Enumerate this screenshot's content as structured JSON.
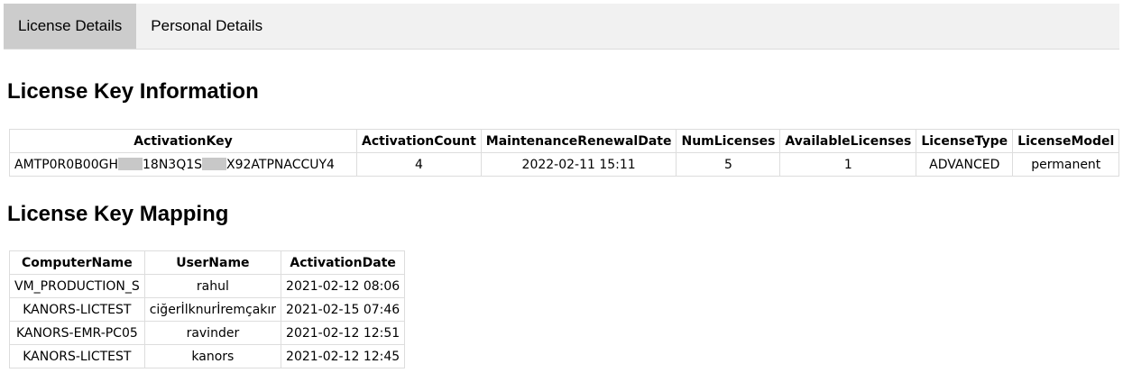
{
  "tabs": [
    {
      "label": "License Details",
      "active": true
    },
    {
      "label": "Personal Details",
      "active": false
    }
  ],
  "info": {
    "heading": "License Key Information",
    "headers": [
      "ActivationKey",
      "ActivationCount",
      "MaintenanceRenewalDate",
      "NumLicenses",
      "AvailableLicenses",
      "LicenseType",
      "LicenseModel"
    ],
    "row": {
      "key_part1": "AMTP0R0B00GH",
      "key_part2": "18N3Q1S",
      "key_part3": "X92ATPNACCUY4",
      "activation_count": "4",
      "maintenance_renewal_date": "2022-02-11 15:11",
      "num_licenses": "5",
      "available_licenses": "1",
      "license_type": "ADVANCED",
      "license_model": "permanent"
    }
  },
  "mapping": {
    "heading": "License Key Mapping",
    "headers": [
      "ComputerName",
      "UserName",
      "ActivationDate"
    ],
    "rows": [
      [
        "VM_PRODUCTION_S",
        "rahul",
        "2021-02-12 08:06"
      ],
      [
        "KANORS-LICTEST",
        "ciğerİlknurİremçakır",
        "2021-02-15 07:46"
      ],
      [
        "KANORS-EMR-PC05",
        "ravinder",
        "2021-02-12 12:51"
      ],
      [
        "KANORS-LICTEST",
        "kanors",
        "2021-02-12 12:45"
      ]
    ]
  },
  "colors": {
    "tabbar_bg": "#f1f1f1",
    "active_tab_bg": "#cccccc",
    "redaction": "#c8c8c8",
    "border": "#dddddd"
  }
}
